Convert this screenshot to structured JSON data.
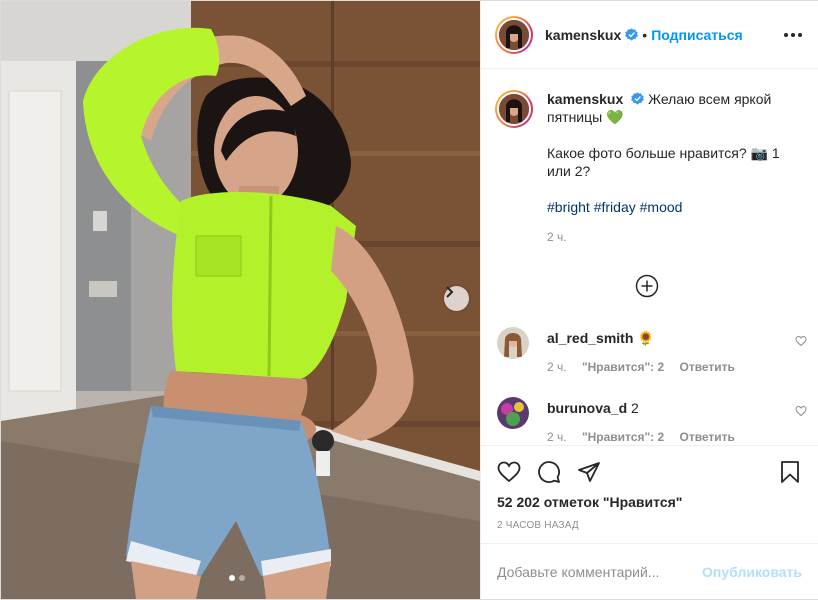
{
  "post": {
    "author": "kamenskux",
    "follow_label": "Подписаться",
    "bullet": "•",
    "verified_icon": "verified-badge-icon",
    "accent_color": "#0095f6"
  },
  "caption": {
    "username": "kamenskux",
    "line1": "Желаю всем яркой пятницы",
    "emoji1": "💚",
    "line2": "Какое фото больше нравится?",
    "emoji2": "📷",
    "line2_tail": "1 или 2?",
    "hashtags": [
      "#bright",
      "#friday",
      "#mood"
    ],
    "time": "2 ч."
  },
  "comments": [
    {
      "username": "al_red_smith",
      "text": "🌻",
      "time": "2 ч.",
      "likes": "\"Нравится\": 2",
      "reply": "Ответить"
    },
    {
      "username": "burunova_d",
      "text": "2",
      "time": "2 ч.",
      "likes": "\"Нравится\": 2",
      "reply": "Ответить"
    }
  ],
  "actions": {
    "likes_text": "52 202 отметок \"Нравится\"",
    "posted_ago": "2 часов назад"
  },
  "composer": {
    "placeholder": "Добавьте комментарий...",
    "publish_label": "Опубликовать"
  },
  "carousel": {
    "current": 1,
    "total": 2
  }
}
